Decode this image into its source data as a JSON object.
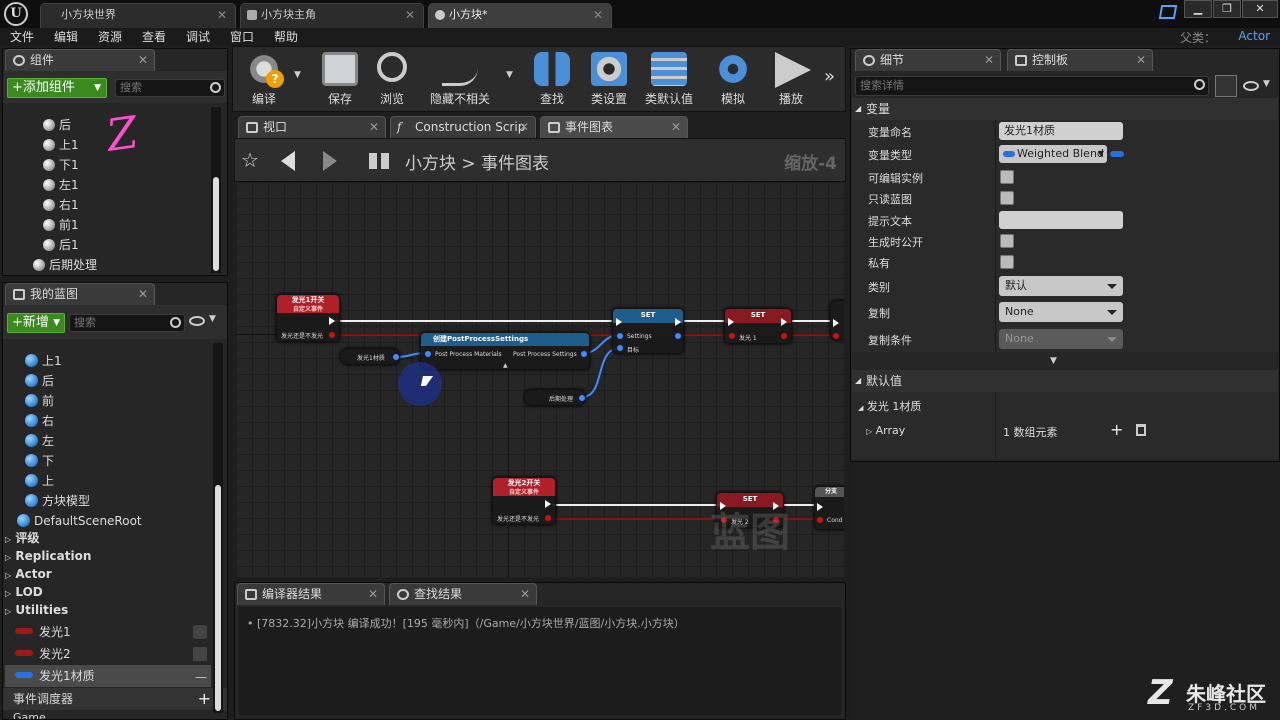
{
  "window": {
    "tabs": [
      {
        "label": "小方块世界"
      },
      {
        "label": "小方块主角"
      },
      {
        "label": "小方块*"
      }
    ],
    "logo": "U"
  },
  "menu": [
    "文件",
    "编辑",
    "资源",
    "查看",
    "调试",
    "窗口",
    "帮助"
  ],
  "parent_class": {
    "label": "父类：",
    "value": "Actor"
  },
  "components": {
    "tab_label": "组件",
    "add_button": "+添加组件",
    "search_placeholder": "搜索",
    "items": [
      "后",
      "上1",
      "下1",
      "左1",
      "右1",
      "前1",
      "后1",
      "后期处理"
    ]
  },
  "my_blueprint": {
    "tab_label": "我的蓝图",
    "new_button": "+新增",
    "search_placeholder": "搜索",
    "items": [
      "上1",
      "后",
      "前",
      "右",
      "左",
      "下",
      "上",
      "方块模型",
      "DefaultSceneRoot"
    ],
    "categories": [
      "评级",
      "Replication",
      "Actor",
      "LOD",
      "Utilities"
    ],
    "variables": [
      {
        "name": "发光1",
        "color": "#a01818"
      },
      {
        "name": "发光2",
        "color": "#a01818"
      },
      {
        "name": "发光1材质",
        "color": "#2a6fe0"
      }
    ],
    "dispatcher_label": "事件调度器",
    "more_label": "Game"
  },
  "toolbar": {
    "buttons": [
      {
        "label": "编译",
        "icon": "gear-question-icon"
      },
      {
        "label": "保存",
        "icon": "floppy-icon"
      },
      {
        "label": "浏览",
        "icon": "magnifier-icon"
      },
      {
        "label": "隐藏不相关",
        "icon": "wire-icon"
      },
      {
        "label": "查找",
        "icon": "binoculars-icon"
      },
      {
        "label": "类设置",
        "icon": "settings-icon"
      },
      {
        "label": "类默认值",
        "icon": "defaults-icon"
      },
      {
        "label": "模拟",
        "icon": "simulate-icon"
      },
      {
        "label": "播放",
        "icon": "play-icon"
      }
    ]
  },
  "editor_tabs": [
    {
      "label": "视口"
    },
    {
      "label": "Construction Scrip"
    },
    {
      "label": "事件图表"
    }
  ],
  "graph": {
    "breadcrumb_root": "小方块",
    "breadcrumb_sep": ">",
    "breadcrumb_page": "事件图表",
    "zoom": "缩放-4",
    "watermark": "蓝图",
    "nodes": {
      "event1_title": "发光1开关",
      "event1_sub": "自定义事件",
      "event1_pin": "发光还是不发光",
      "var1": "发光1材质",
      "make_title": "创建PostProcessSettings",
      "make_in": "Post Process Materials",
      "make_out": "Post Process Settings",
      "set1_title": "SET",
      "set1_pin1": "Settings",
      "set1_pin2": "目标",
      "set2_title": "SET",
      "set2_pin": "发光 1",
      "postproc": "后期处理",
      "event2_title": "发光2开关",
      "event2_sub": "自定义事件",
      "event2_pin": "发光还是不发光",
      "set3_title": "SET",
      "set3_pin": "发光 2",
      "branch_label": "分支",
      "cond_label": "Cond"
    }
  },
  "output": {
    "tabs": [
      {
        "label": "编译器结果"
      },
      {
        "label": "查找结果"
      }
    ],
    "log": "[7832.32]小方块 编译成功！[195 毫秒内]（/Game/小方块世界/蓝图/小方块.小方块）"
  },
  "details": {
    "tabs": [
      {
        "label": "细节"
      },
      {
        "label": "控制板"
      }
    ],
    "search_placeholder": "搜索详情",
    "variable_section": "变量",
    "props": {
      "name_label": "变量命名",
      "name_value": "发光1材质",
      "type_label": "变量类型",
      "type_value": "Weighted Blend",
      "editable_label": "可编辑实例",
      "readonly_label": "只读蓝图",
      "tooltip_label": "提示文本",
      "expose_label": "生成时公开",
      "private_label": "私有",
      "category_label": "类别",
      "category_value": "默认",
      "replication_label": "复制",
      "replication_value": "None",
      "repcond_label": "复制条件",
      "repcond_value": "None"
    },
    "defaults_section": "默认值",
    "default_var": "发光 1材质",
    "array_label": "Array",
    "array_value": "1 数组元素"
  },
  "overlay": {
    "handwriting": "Z",
    "site_name": "朱峰社区",
    "site_url": "ZF3D.COM"
  }
}
